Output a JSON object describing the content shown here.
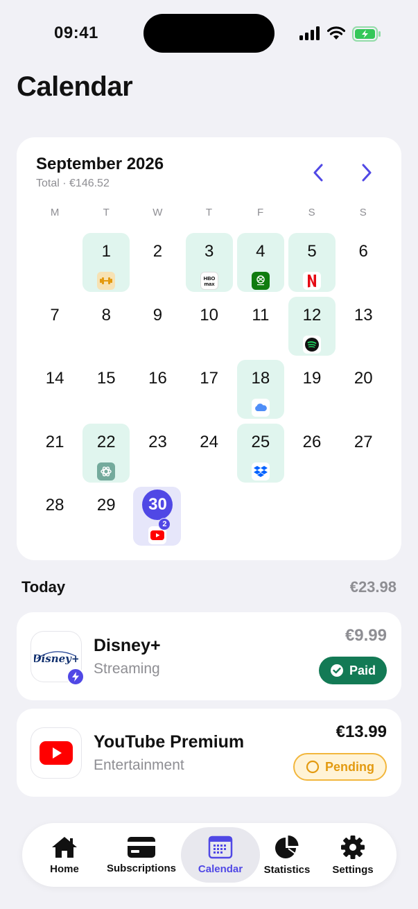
{
  "status_bar": {
    "time": "09:41"
  },
  "page_title": "Calendar",
  "calendar": {
    "month": "September 2026",
    "total": "Total · €146.52",
    "weekdays": [
      "M",
      "T",
      "W",
      "T",
      "F",
      "S",
      "S"
    ],
    "days": [
      {
        "num": "",
        "sub": null
      },
      {
        "num": "1",
        "sub": "fitness-icon"
      },
      {
        "num": "2",
        "sub": null
      },
      {
        "num": "3",
        "sub": "hbo-max-icon"
      },
      {
        "num": "4",
        "sub": "xbox-game-pass-icon"
      },
      {
        "num": "5",
        "sub": "netflix-icon"
      },
      {
        "num": "6",
        "sub": null
      },
      {
        "num": "7",
        "sub": null
      },
      {
        "num": "8",
        "sub": null
      },
      {
        "num": "9",
        "sub": null
      },
      {
        "num": "10",
        "sub": null
      },
      {
        "num": "11",
        "sub": null
      },
      {
        "num": "12",
        "sub": "spotify-icon"
      },
      {
        "num": "13",
        "sub": null
      },
      {
        "num": "14",
        "sub": null
      },
      {
        "num": "15",
        "sub": null
      },
      {
        "num": "16",
        "sub": null
      },
      {
        "num": "17",
        "sub": null
      },
      {
        "num": "18",
        "sub": "icloud-icon"
      },
      {
        "num": "19",
        "sub": null
      },
      {
        "num": "20",
        "sub": null
      },
      {
        "num": "21",
        "sub": null
      },
      {
        "num": "22",
        "sub": "chatgpt-icon"
      },
      {
        "num": "23",
        "sub": null
      },
      {
        "num": "24",
        "sub": null
      },
      {
        "num": "25",
        "sub": "dropbox-icon"
      },
      {
        "num": "26",
        "sub": null
      },
      {
        "num": "27",
        "sub": null
      },
      {
        "num": "28",
        "sub": null
      },
      {
        "num": "29",
        "sub": null
      },
      {
        "num": "30",
        "sub": "youtube-icon",
        "today": true,
        "count": "2"
      }
    ]
  },
  "today": {
    "label": "Today",
    "total": "€23.98",
    "items": [
      {
        "name": "Disney+",
        "category": "Streaming",
        "price": "€9.99",
        "status": "Paid",
        "logo_text": "Disney+"
      },
      {
        "name": "YouTube Premium",
        "category": "Entertainment",
        "price": "€13.99",
        "status": "Pending"
      }
    ]
  },
  "tabs": [
    {
      "label": "Home",
      "icon": "home-icon"
    },
    {
      "label": "Subscriptions",
      "icon": "card-icon"
    },
    {
      "label": "Calendar",
      "icon": "calendar-icon",
      "active": true
    },
    {
      "label": "Statistics",
      "icon": "pie-chart-icon"
    },
    {
      "label": "Settings",
      "icon": "gear-icon"
    }
  ],
  "colors": {
    "accent": "#5048E5",
    "subscription_day_bg": "#E0F5EE",
    "paid": "#137A55",
    "pending": "#E39A10",
    "background": "#F1F1F6"
  }
}
